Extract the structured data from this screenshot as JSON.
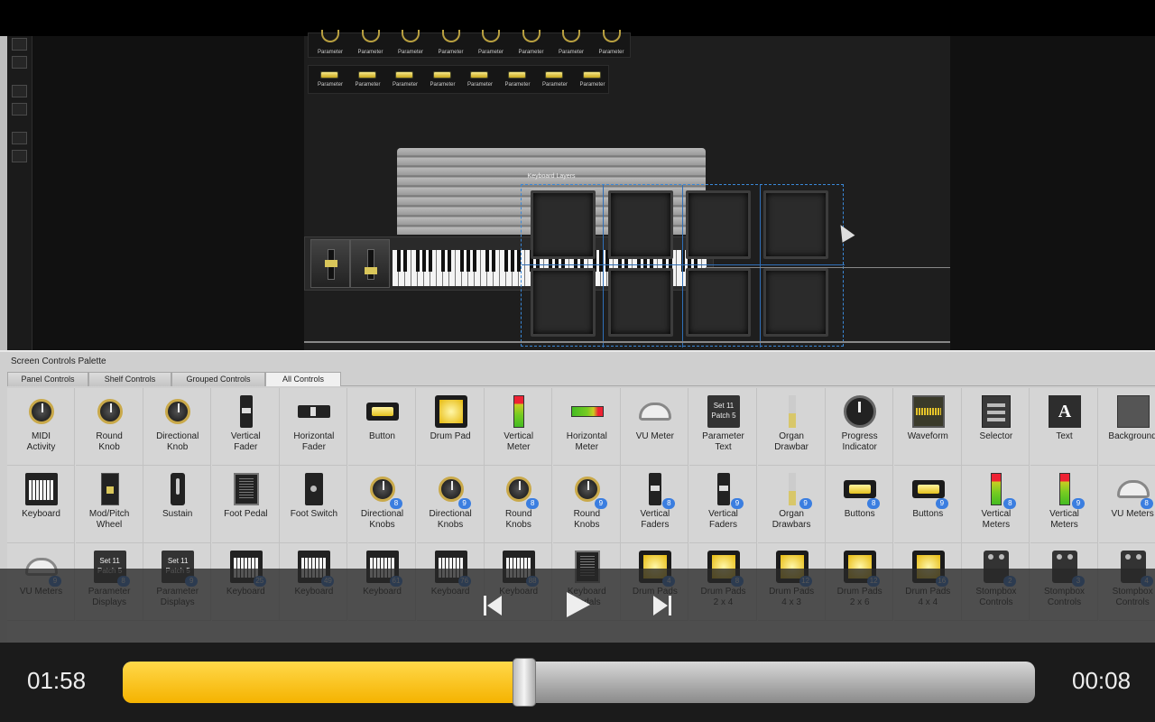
{
  "player": {
    "elapsed": "01:58",
    "remaining": "00:08",
    "progress_fraction": 0.44
  },
  "canvas": {
    "param_label": "Parameter",
    "keyboard_layers_label": "Keyboard Layers"
  },
  "palette": {
    "title": "Screen Controls Palette",
    "tabs": [
      "Panel Controls",
      "Shelf Controls",
      "Grouped Controls",
      "All Controls"
    ],
    "active_tab": "All Controls",
    "rows": [
      [
        {
          "label": "MIDI\nActivity",
          "icon": "midi-activity-icon"
        },
        {
          "label": "Round\nKnob",
          "icon": "round-knob-icon"
        },
        {
          "label": "Directional\nKnob",
          "icon": "directional-knob-icon"
        },
        {
          "label": "Vertical\nFader",
          "icon": "vertical-fader-icon"
        },
        {
          "label": "Horizontal\nFader",
          "icon": "horizontal-fader-icon"
        },
        {
          "label": "Button",
          "icon": "button-icon"
        },
        {
          "label": "Drum Pad",
          "icon": "drum-pad-icon"
        },
        {
          "label": "Vertical\nMeter",
          "icon": "vertical-meter-icon"
        },
        {
          "label": "Horizontal\nMeter",
          "icon": "horizontal-meter-icon"
        },
        {
          "label": "VU Meter",
          "icon": "vu-meter-icon"
        },
        {
          "label": "Parameter\nText",
          "icon": "parameter-text-icon",
          "text": "Set 11\nPatch 5"
        },
        {
          "label": "Organ\nDrawbar",
          "icon": "organ-drawbar-icon"
        },
        {
          "label": "Progress\nIndicator",
          "icon": "progress-indicator-icon"
        },
        {
          "label": "Waveform",
          "icon": "waveform-icon"
        },
        {
          "label": "Selector",
          "icon": "selector-icon"
        },
        {
          "label": "Text",
          "icon": "text-icon",
          "text": "A"
        },
        {
          "label": "Background",
          "icon": "background-icon"
        }
      ],
      [
        {
          "label": "Keyboard",
          "icon": "keyboard-icon"
        },
        {
          "label": "Mod/Pitch\nWheel",
          "icon": "mod-pitch-wheel-icon"
        },
        {
          "label": "Sustain",
          "icon": "sustain-icon"
        },
        {
          "label": "Foot Pedal",
          "icon": "foot-pedal-icon"
        },
        {
          "label": "Foot Switch",
          "icon": "foot-switch-icon"
        },
        {
          "label": "Directional\nKnobs",
          "icon": "directional-knob-icon",
          "badge": "8"
        },
        {
          "label": "Directional\nKnobs",
          "icon": "directional-knob-icon",
          "badge": "9"
        },
        {
          "label": "Round\nKnobs",
          "icon": "round-knob-icon",
          "badge": "8"
        },
        {
          "label": "Round\nKnobs",
          "icon": "round-knob-icon",
          "badge": "9"
        },
        {
          "label": "Vertical\nFaders",
          "icon": "vertical-fader-icon",
          "badge": "8"
        },
        {
          "label": "Vertical\nFaders",
          "icon": "vertical-fader-icon",
          "badge": "9"
        },
        {
          "label": "Organ\nDrawbars",
          "icon": "organ-drawbar-icon",
          "badge": "9"
        },
        {
          "label": "Buttons",
          "icon": "button-icon",
          "badge": "8"
        },
        {
          "label": "Buttons",
          "icon": "button-icon",
          "badge": "9"
        },
        {
          "label": "Vertical\nMeters",
          "icon": "vertical-meter-icon",
          "badge": "8"
        },
        {
          "label": "Vertical\nMeters",
          "icon": "vertical-meter-icon",
          "badge": "9"
        },
        {
          "label": "VU Meters",
          "icon": "vu-meter-icon",
          "badge": "8"
        }
      ],
      [
        {
          "label": "VU Meters",
          "icon": "vu-meter-icon",
          "badge": "9"
        },
        {
          "label": "Parameter\nDisplays",
          "icon": "parameter-text-icon",
          "text": "Set 11\nPatch 5",
          "badge": "8"
        },
        {
          "label": "Parameter\nDisplays",
          "icon": "parameter-text-icon",
          "text": "Set 11\nPatch 5",
          "badge": "9"
        },
        {
          "label": "Keyboard",
          "icon": "keyboard-icon",
          "badge": "25"
        },
        {
          "label": "Keyboard",
          "icon": "keyboard-icon",
          "badge": "49"
        },
        {
          "label": "Keyboard",
          "icon": "keyboard-icon",
          "badge": "61"
        },
        {
          "label": "Keyboard",
          "icon": "keyboard-icon",
          "badge": "76"
        },
        {
          "label": "Keyboard",
          "icon": "keyboard-icon",
          "badge": "88"
        },
        {
          "label": "Keyboard\nPedals",
          "icon": "foot-pedal-icon"
        },
        {
          "label": "Drum Pads",
          "icon": "drum-pad-icon",
          "badge": "4"
        },
        {
          "label": "Drum Pads\n2 x 4",
          "icon": "drum-pad-icon",
          "badge": "8"
        },
        {
          "label": "Drum Pads\n4 x 3",
          "icon": "drum-pad-icon",
          "badge": "12"
        },
        {
          "label": "Drum Pads\n2 x 6",
          "icon": "drum-pad-icon",
          "badge": "12"
        },
        {
          "label": "Drum Pads\n4 x 4",
          "icon": "drum-pad-icon",
          "badge": "16"
        },
        {
          "label": "Stompbox\nControls",
          "icon": "stompbox-icon",
          "badge": "2"
        },
        {
          "label": "Stompbox\nControls",
          "icon": "stompbox-icon",
          "badge": "3"
        },
        {
          "label": "Stompbox\nControls",
          "icon": "stompbox-icon",
          "badge": "4"
        }
      ]
    ]
  }
}
